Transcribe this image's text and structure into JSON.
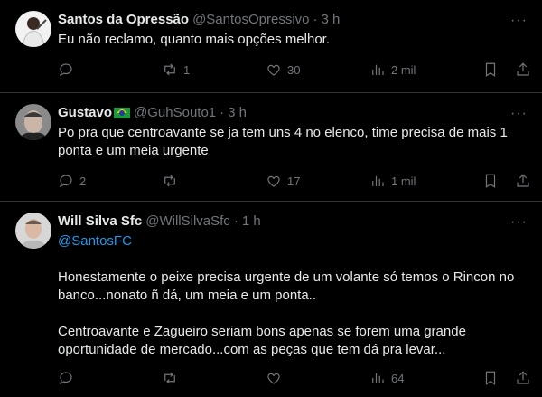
{
  "tweets": [
    {
      "name": "Santos da Opressão",
      "handle": "@SantosOpressivo",
      "dot": "·",
      "time": "3 h",
      "text": "Eu não reclamo, quanto mais opções melhor.",
      "replies": "",
      "retweets": "1",
      "likes": "30",
      "views": "2 mil"
    },
    {
      "name": "Gustavo",
      "handle": "@GuhSouto1",
      "dot": "·",
      "time": "3 h",
      "text": "Po pra que centroavante se ja tem uns 4 no elenco, time precisa de mais 1 ponta e um meia urgente",
      "replies": "2",
      "retweets": "",
      "likes": "17",
      "views": "1 mil"
    },
    {
      "name": "Will Silva Sfc",
      "handle": "@WillSilvaSfc",
      "dot": "·",
      "time": "1 h",
      "mention": "@SantosFC",
      "text": "Honestamente o peixe precisa urgente de um volante só temos o Rincon no banco...nonato ñ dá, um meia e um ponta..\n\nCentroavante e Zagueiro seriam bons apenas se forem uma grande oportunidade de mercado...com as peças que tem dá pra levar...",
      "replies": "",
      "retweets": "",
      "likes": "",
      "views": "64"
    }
  ],
  "icons": [
    "more-icon",
    "reply-icon",
    "retweet-icon",
    "like-icon",
    "views-icon",
    "bookmark-icon",
    "share-icon",
    "brazil-flag-icon"
  ],
  "colors": {
    "background": "#000000",
    "text": "#e7e9ea",
    "muted": "#71767b",
    "link": "#1d9bf0",
    "border": "#2f3336"
  }
}
